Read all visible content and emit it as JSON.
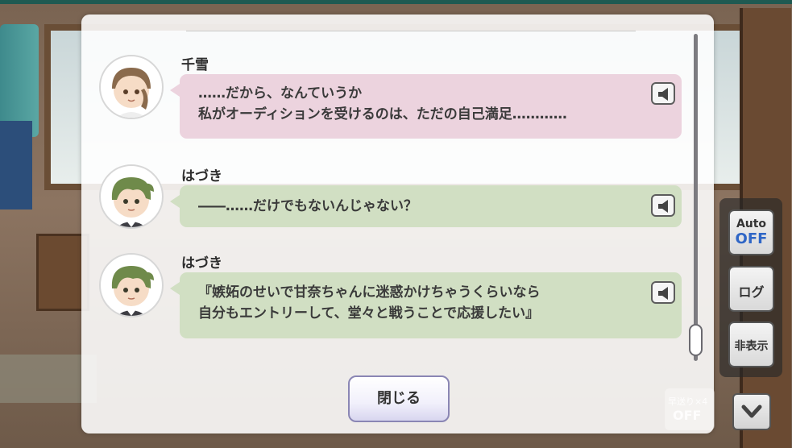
{
  "log": {
    "entries": [
      {
        "speaker": "千雪",
        "lines": [
          "……だから、なんていうか",
          "私がオーディションを受けるのは、ただの自己満足…………"
        ],
        "voice_icon": "speaker-icon"
      },
      {
        "speaker": "はづき",
        "lines": [
          "――……だけでもないんじゃない？"
        ],
        "voice_icon": "speaker-icon"
      },
      {
        "speaker": "はづき",
        "lines": [
          "『嫉妬のせいで甘奈ちゃんに迷惑かけちゃうくらいなら",
          "自分もエントリーして、堂々と戦うことで応援したい』"
        ],
        "voice_icon": "speaker-icon"
      }
    ],
    "close_label": "閉じる",
    "colors": {
      "pink_bubble": "#ecd3de",
      "green_bubble": "#d1dfc3"
    }
  },
  "controls": {
    "auto_label": "Auto",
    "auto_state": "OFF",
    "log_label": "ログ",
    "hide_label": "非表示",
    "speed_label": "早送り×4",
    "speed_state": "OFF",
    "down_icon": "chevron-down-icon"
  }
}
